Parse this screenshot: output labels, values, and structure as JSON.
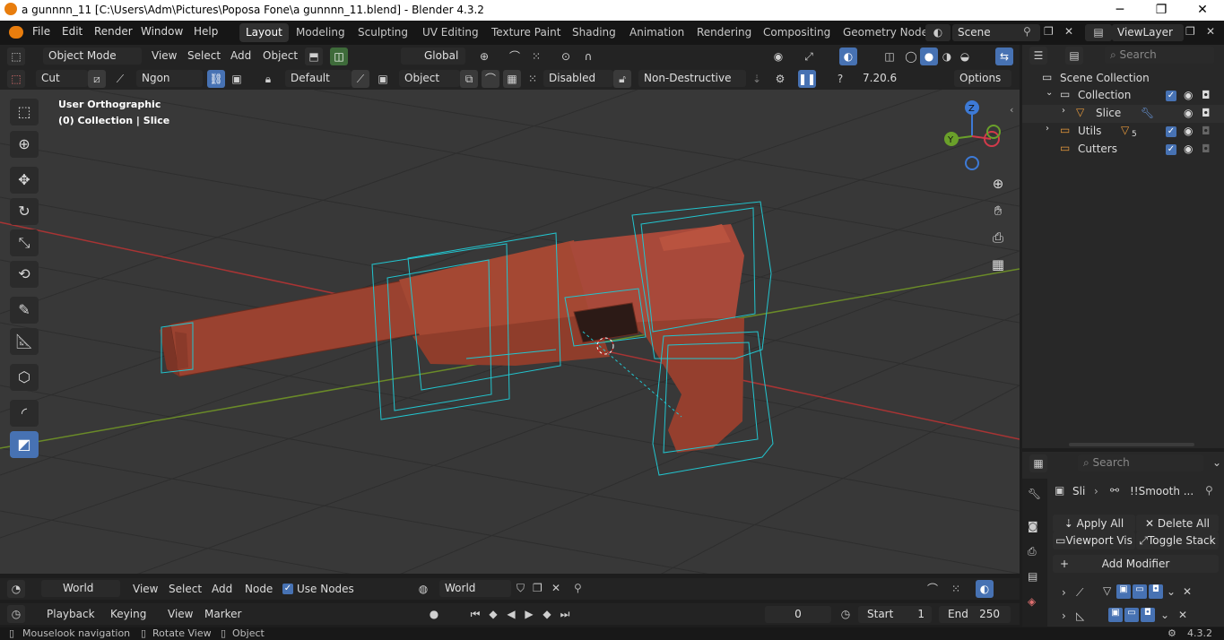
{
  "window": {
    "title": "a gunnnn_11 [C:\\Users\\Adm\\Pictures\\Poposa Fone\\a gunnnn_11.blend] - Blender 4.3.2",
    "minimize": "─",
    "maximize": "❐",
    "close": "✕"
  },
  "menu": {
    "items": [
      "File",
      "Edit",
      "Render",
      "Window",
      "Help"
    ],
    "workspaces": [
      "Layout",
      "Modeling",
      "Sculpting",
      "UV Editing",
      "Texture Paint",
      "Shading",
      "Animation",
      "Rendering",
      "Compositing",
      "Geometry Node"
    ],
    "active_workspace": "Layout",
    "scene": "Scene",
    "view_layer": "ViewLayer"
  },
  "viewport_header": {
    "mode": "Object Mode",
    "menus": [
      "View",
      "Select",
      "Add",
      "Object"
    ],
    "transform_orientation": "Global"
  },
  "tool_header": {
    "tool": "Cut",
    "geometry": "Ngon",
    "default": "Default",
    "object": "Object",
    "disabled": "Disabled",
    "mode": "Non-Destructive",
    "version_value": "7.20.6",
    "options": "Options"
  },
  "viewport": {
    "view_name": "User Orthographic",
    "collection_info": "(0) Collection | Slice",
    "gizmo": {
      "x": "X",
      "y": "Y",
      "z": "Z"
    }
  },
  "outliner": {
    "search_placeholder": "Search",
    "root": "Scene Collection",
    "rows": [
      {
        "label": "Collection"
      },
      {
        "label": "Slice"
      },
      {
        "label": "Utils",
        "badge": "5"
      },
      {
        "label": "Cutters"
      }
    ]
  },
  "properties": {
    "search_placeholder": "Search",
    "breadcrumb_object": "Sli",
    "breadcrumb_modifier": "!!Smooth ...",
    "apply_all": "Apply All",
    "delete_all": "Delete All",
    "viewport_vis": "Viewport Vis",
    "toggle_stack": "Toggle Stack",
    "add_modifier": "Add Modifier"
  },
  "node_header": {
    "world_type": "World",
    "menus": [
      "View",
      "Select",
      "Add",
      "Node"
    ],
    "use_nodes": "Use Nodes",
    "world_name": "World"
  },
  "timeline": {
    "menus": [
      "Playback",
      "Keying",
      "View",
      "Marker"
    ],
    "current_frame": "0",
    "start_label": "Start",
    "start": "1",
    "end_label": "End",
    "end": "250"
  },
  "status": {
    "items": [
      "Mouselook navigation",
      "Rotate View",
      "Object"
    ],
    "version": "4.3.2"
  },
  "colors": {
    "accent": "#4772b3",
    "model": "#a04733",
    "cutter_wire": "#1ec8d2",
    "grid_red": "#b03a3a",
    "grid_green": "#6c8a2a"
  }
}
